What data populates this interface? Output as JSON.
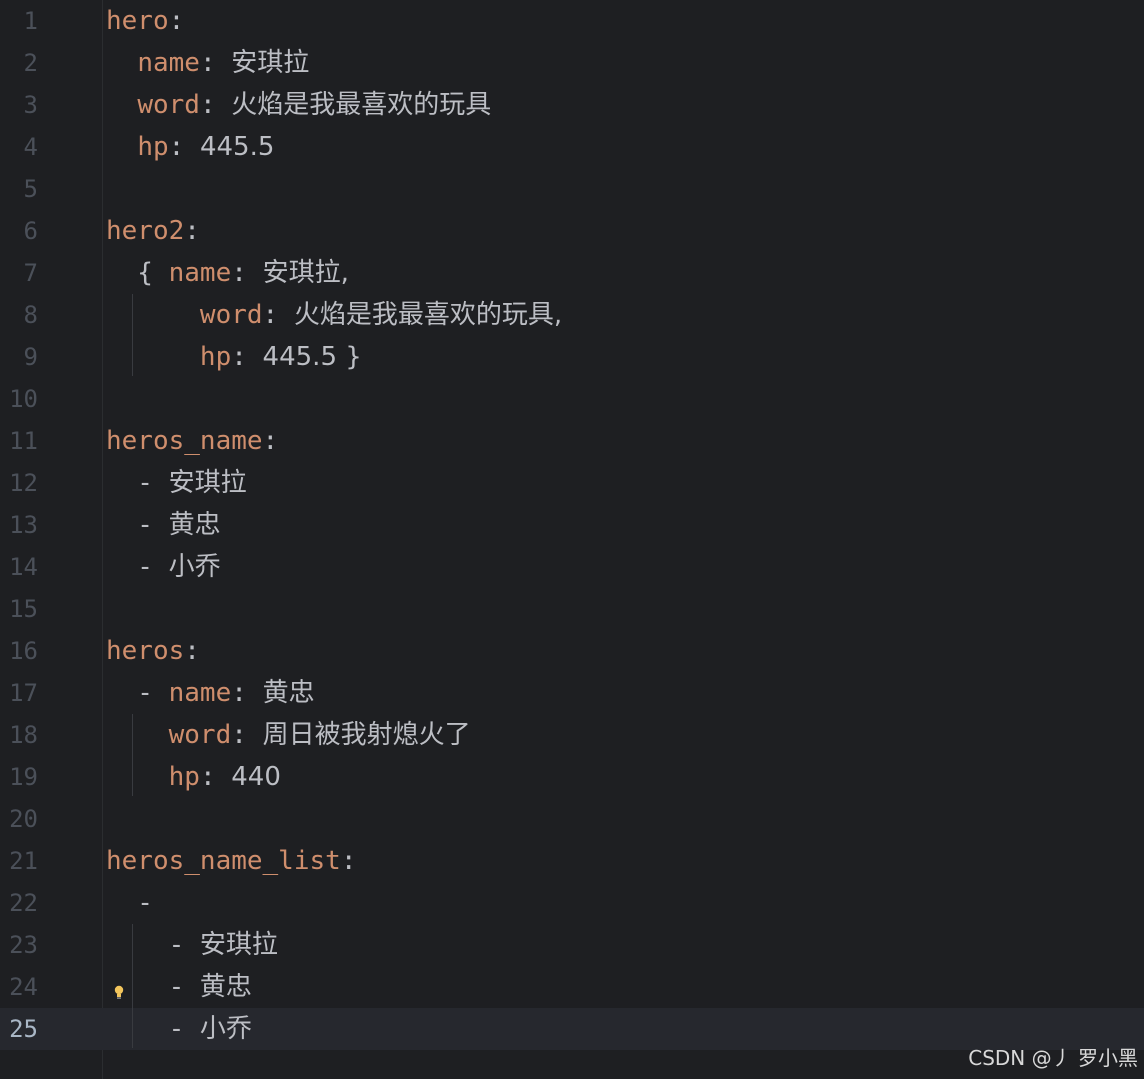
{
  "lines": [
    {
      "n": "1",
      "indent": "",
      "key": "hero",
      "sep": ":",
      "value": ""
    },
    {
      "n": "2",
      "indent": "  ",
      "key": "name",
      "sep": ": ",
      "value": "安琪拉"
    },
    {
      "n": "3",
      "indent": "  ",
      "key": "word",
      "sep": ": ",
      "value": "火焰是我最喜欢的玩具"
    },
    {
      "n": "4",
      "indent": "  ",
      "key": "hp",
      "sep": ": ",
      "value": "445.5"
    },
    {
      "n": "5",
      "indent": "",
      "key": "",
      "sep": "",
      "value": ""
    },
    {
      "n": "6",
      "indent": "",
      "key": "hero2",
      "sep": ":",
      "value": ""
    },
    {
      "n": "7",
      "indent": "  { ",
      "key": "name",
      "sep": ": ",
      "value": "安琪拉,"
    },
    {
      "n": "8",
      "indent": "      ",
      "key": "word",
      "sep": ": ",
      "value": "火焰是我最喜欢的玩具,"
    },
    {
      "n": "9",
      "indent": "      ",
      "key": "hp",
      "sep": ": ",
      "value": "445.5 }"
    },
    {
      "n": "10",
      "indent": "",
      "key": "",
      "sep": "",
      "value": ""
    },
    {
      "n": "11",
      "indent": "",
      "key": "heros_name",
      "sep": ":",
      "value": ""
    },
    {
      "n": "12",
      "indent": "  - ",
      "key": "",
      "sep": "",
      "value": "安琪拉"
    },
    {
      "n": "13",
      "indent": "  - ",
      "key": "",
      "sep": "",
      "value": "黄忠"
    },
    {
      "n": "14",
      "indent": "  - ",
      "key": "",
      "sep": "",
      "value": "小乔"
    },
    {
      "n": "15",
      "indent": "",
      "key": "",
      "sep": "",
      "value": ""
    },
    {
      "n": "16",
      "indent": "",
      "key": "heros",
      "sep": ":",
      "value": ""
    },
    {
      "n": "17",
      "indent": "  - ",
      "key": "name",
      "sep": ": ",
      "value": "黄忠"
    },
    {
      "n": "18",
      "indent": "    ",
      "key": "word",
      "sep": ": ",
      "value": "周日被我射熄火了"
    },
    {
      "n": "19",
      "indent": "    ",
      "key": "hp",
      "sep": ": ",
      "value": "440"
    },
    {
      "n": "20",
      "indent": "",
      "key": "",
      "sep": "",
      "value": ""
    },
    {
      "n": "21",
      "indent": "",
      "key": "heros_name_list",
      "sep": ":",
      "value": ""
    },
    {
      "n": "22",
      "indent": "  -",
      "key": "",
      "sep": "",
      "value": ""
    },
    {
      "n": "23",
      "indent": "    - ",
      "key": "",
      "sep": "",
      "value": "安琪拉"
    },
    {
      "n": "24",
      "indent": "    - ",
      "key": "",
      "sep": "",
      "value": "黄忠"
    },
    {
      "n": "25",
      "indent": "    - ",
      "key": "",
      "sep": "",
      "value": "小乔"
    }
  ],
  "current_line": "25",
  "watermark": "CSDN @丿 罗小黑",
  "icons": {
    "intention": "lightbulb-icon"
  },
  "colors": {
    "background": "#1e1f22",
    "key": "#cf8e6d",
    "text": "#bcbec4",
    "line_number": "#4b5059",
    "current_line": "#26282e"
  }
}
